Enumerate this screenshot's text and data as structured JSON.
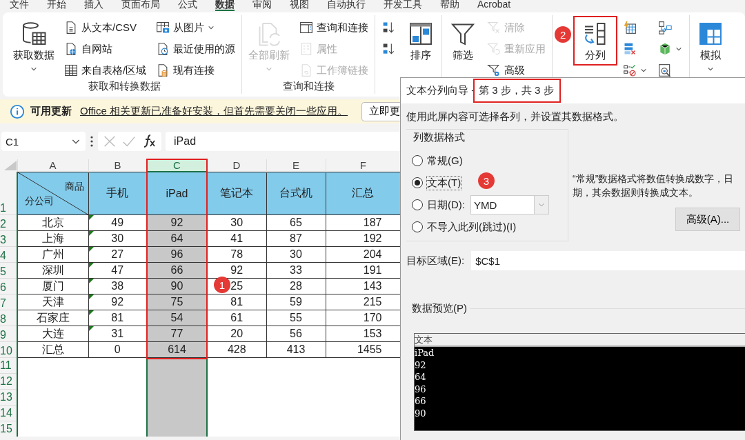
{
  "menu_tabs": [
    {
      "label": "文件",
      "selected": false
    },
    {
      "label": "开始",
      "selected": false
    },
    {
      "label": "插入",
      "selected": false
    },
    {
      "label": "页面布局",
      "selected": false
    },
    {
      "label": "公式",
      "selected": false
    },
    {
      "label": "数据",
      "selected": true
    },
    {
      "label": "审阅",
      "selected": false
    },
    {
      "label": "视图",
      "selected": false
    },
    {
      "label": "自动执行",
      "selected": false
    },
    {
      "label": "开发工具",
      "selected": false
    },
    {
      "label": "帮助",
      "selected": false
    },
    {
      "label": "Acrobat",
      "selected": false
    }
  ],
  "ribbon": {
    "groups": [
      {
        "label": "获取和转换数据",
        "columns": [
          [
            {
              "label": "获取数据",
              "kind": "large",
              "dropdown": true,
              "disabled": false
            }
          ],
          [
            {
              "label": "从文本/CSV",
              "kind": "small",
              "dropdown": false,
              "disabled": false
            },
            {
              "label": "自网站",
              "kind": "small",
              "dropdown": false,
              "disabled": false
            },
            {
              "label": "来自表格/区域",
              "kind": "small",
              "dropdown": false,
              "disabled": false
            }
          ],
          [
            {
              "label": "从图片",
              "kind": "small",
              "dropdown": true,
              "disabled": false
            },
            {
              "label": "最近使用的源",
              "kind": "small",
              "dropdown": false,
              "disabled": false
            },
            {
              "label": "现有连接",
              "kind": "small",
              "dropdown": false,
              "disabled": false
            }
          ]
        ]
      },
      {
        "label": "查询和连接",
        "columns": [
          [
            {
              "label": "全部刷新",
              "kind": "large",
              "dropdown": true,
              "disabled": true
            }
          ],
          [
            {
              "label": "查询和连接",
              "kind": "small",
              "dropdown": false,
              "disabled": false
            },
            {
              "label": "属性",
              "kind": "small",
              "dropdown": false,
              "disabled": true
            },
            {
              "label": "工作簿链接",
              "kind": "small",
              "dropdown": false,
              "disabled": true
            }
          ]
        ]
      },
      {
        "columns": [
          [
            {
              "kind": "icon",
              "dropdown": false,
              "disabled": false
            },
            {
              "kind": "icon",
              "dropdown": false,
              "disabled": false
            }
          ],
          [
            {
              "label": "排序",
              "kind": "large",
              "dropdown": false,
              "disabled": false
            }
          ]
        ]
      },
      {
        "columns": [
          [
            {
              "label": "筛选",
              "kind": "large",
              "dropdown": false,
              "disabled": false
            }
          ],
          [
            {
              "label": "清除",
              "kind": "small",
              "dropdown": false,
              "disabled": true
            },
            {
              "label": "重新应用",
              "kind": "small",
              "dropdown": false,
              "disabled": true
            },
            {
              "label": "高级",
              "kind": "small",
              "dropdown": false,
              "disabled": false
            }
          ]
        ]
      },
      {
        "columns": [
          [
            {
              "label": "分列",
              "kind": "large",
              "dropdown": false,
              "disabled": false,
              "highlighted": true
            }
          ],
          [
            {
              "kind": "icon",
              "dropdown": false,
              "disabled": false
            },
            {
              "kind": "icon",
              "dropdown": false,
              "disabled": false
            },
            {
              "kind": "icon",
              "dropdown": true,
              "disabled": false
            }
          ],
          [
            {
              "kind": "icon",
              "dropdown": false,
              "disabled": false
            },
            {
              "kind": "icon",
              "dropdown": true,
              "disabled": false
            },
            {
              "kind": "icon",
              "dropdown": false,
              "disabled": false
            }
          ]
        ]
      },
      {
        "columns": [
          [
            {
              "label": "模拟",
              "kind": "large",
              "dropdown": true,
              "disabled": false
            }
          ]
        ]
      }
    ]
  },
  "update_bar": {
    "title": "可用更新",
    "message": "Office 相关更新已准备好安装，但首先需要关闭一些应用。",
    "button": "立即更"
  },
  "formula_bar": {
    "name_box": "C1",
    "formula": "iPad"
  },
  "sheet": {
    "columns": [
      {
        "letter": "A",
        "selected": false,
        "highlighted": false
      },
      {
        "letter": "B",
        "selected": false,
        "highlighted": false
      },
      {
        "letter": "C",
        "selected": true,
        "highlighted": true
      },
      {
        "letter": "D",
        "selected": false,
        "highlighted": false
      },
      {
        "letter": "E",
        "selected": false,
        "highlighted": false
      },
      {
        "letter": "F",
        "selected": false,
        "highlighted": false
      }
    ],
    "header_row": {
      "number": "1",
      "corner_top": "商品",
      "corner_bottom": "分公司",
      "cells": [
        "手机",
        "iPad",
        "笔记本",
        "台式机",
        "汇总"
      ]
    },
    "rows": [
      {
        "number": "2",
        "flagged": true,
        "cells": [
          "北京",
          "49",
          "92",
          "30",
          "65",
          "187"
        ]
      },
      {
        "number": "3",
        "flagged": true,
        "cells": [
          "上海",
          "30",
          "64",
          "41",
          "87",
          "192"
        ]
      },
      {
        "number": "4",
        "flagged": true,
        "cells": [
          "广州",
          "27",
          "96",
          "78",
          "30",
          "204"
        ]
      },
      {
        "number": "5",
        "flagged": true,
        "cells": [
          "深圳",
          "47",
          "66",
          "92",
          "33",
          "191"
        ]
      },
      {
        "number": "6",
        "flagged": true,
        "cells": [
          "厦门",
          "38",
          "90",
          "25",
          "28",
          "143"
        ]
      },
      {
        "number": "7",
        "flagged": true,
        "cells": [
          "天津",
          "92",
          "75",
          "81",
          "59",
          "215"
        ]
      },
      {
        "number": "8",
        "flagged": true,
        "cells": [
          "石家庄",
          "81",
          "54",
          "61",
          "55",
          "170"
        ]
      },
      {
        "number": "9",
        "flagged": true,
        "cells": [
          "大连",
          "31",
          "77",
          "20",
          "56",
          "153"
        ]
      },
      {
        "number": "10",
        "flagged": false,
        "cells": [
          "汇总",
          "0",
          "614",
          "428",
          "413",
          "1455"
        ]
      }
    ],
    "empty_rows": [
      "11",
      "12",
      "13",
      "14",
      "15"
    ]
  },
  "dialog": {
    "title": "文本分列向导 - ",
    "step": {
      "text": "第 3 步，共 3 步",
      "highlighted": true
    },
    "instruction": "使用此屏内容可选择各列，并设置其数据格式。",
    "format_group": {
      "legend": "列数据格式",
      "options": [
        {
          "label": "常规(G)",
          "selected": false
        },
        {
          "label": "文本(T)",
          "selected": true
        },
        {
          "label": "日期(D):",
          "selected": false
        },
        {
          "label": "不导入此列(跳过)(I)",
          "selected": false
        }
      ],
      "date_format": "YMD"
    },
    "description": [
      "“常规”数据格式将数值转换成数字，日",
      "期，其余数据则转换成文本。"
    ],
    "advanced_button": "高级(A)...",
    "destination": {
      "label": "目标区域(E):",
      "value": "$C$1"
    },
    "preview": {
      "label": "数据预览(P)",
      "header": "文本",
      "rows": [
        "iPad",
        "92",
        "64",
        "96",
        "66",
        "90"
      ]
    }
  },
  "markers": [
    {
      "text": "1"
    },
    {
      "text": "2"
    },
    {
      "text": "3"
    }
  ]
}
